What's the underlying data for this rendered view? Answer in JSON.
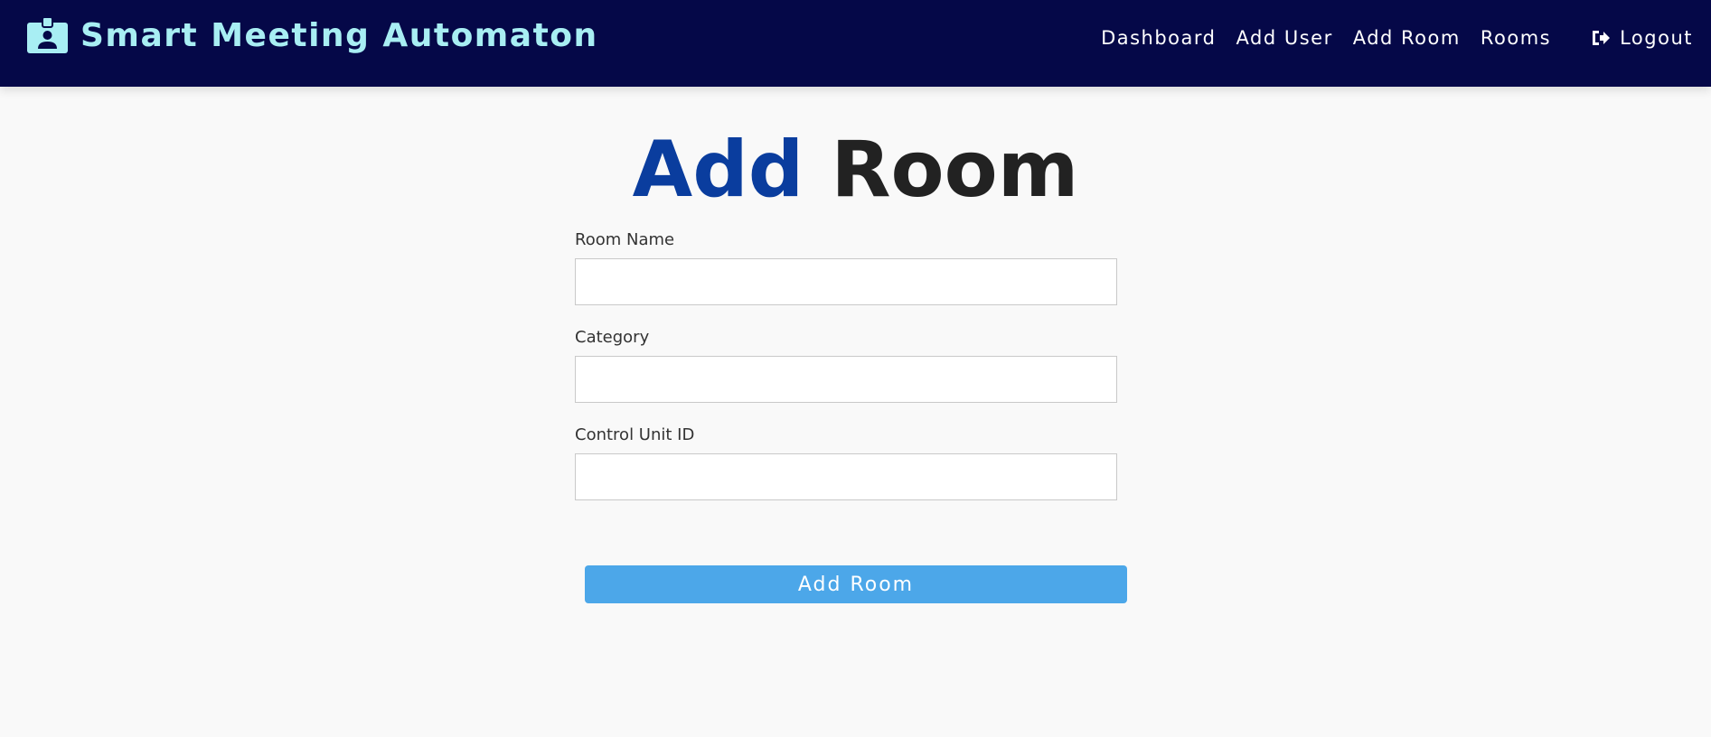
{
  "header": {
    "brand": "Smart Meeting Automaton",
    "brand_icon": "id-badge-icon",
    "nav": {
      "dashboard": "Dashboard",
      "add_user": "Add User",
      "add_room": "Add Room",
      "rooms": "Rooms",
      "logout": "Logout",
      "logout_icon": "sign-out-icon"
    }
  },
  "main": {
    "title_accent": "Add",
    "title_rest": "Room",
    "fields": {
      "room_name": {
        "label": "Room Name",
        "value": ""
      },
      "category": {
        "label": "Category",
        "value": ""
      },
      "control_unit_id": {
        "label": "Control Unit ID",
        "value": ""
      }
    },
    "submit_label": "Add Room"
  },
  "colors": {
    "navbar_bg": "#050848",
    "brand_text": "#a8eef3",
    "title_accent": "#0a3d9e",
    "button_bg": "#4ca7e9",
    "page_bg": "#f9f9f9"
  }
}
